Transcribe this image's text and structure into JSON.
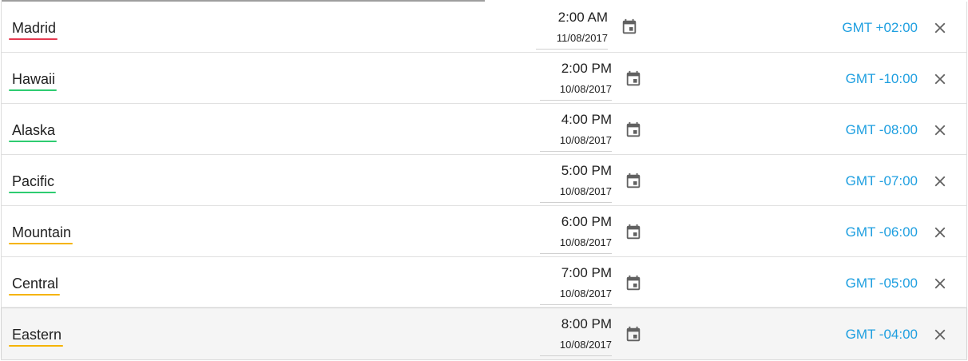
{
  "colors": {
    "accent": "#1e9fe0",
    "icon": "#616161",
    "underline_red": "#e53950",
    "underline_green": "#2ecc71",
    "underline_orange": "#f5b400"
  },
  "icons": {
    "calendar": "calendar-icon",
    "close": "close-icon"
  },
  "timezones": [
    {
      "city": "Madrid",
      "time": "2:00 AM",
      "date": "11/08/2017",
      "offset": "GMT +02:00",
      "underline_color": "#e53950"
    },
    {
      "city": "Hawaii",
      "time": "2:00 PM",
      "date": "10/08/2017",
      "offset": "GMT -10:00",
      "underline_color": "#2ecc71"
    },
    {
      "city": "Alaska",
      "time": "4:00 PM",
      "date": "10/08/2017",
      "offset": "GMT -08:00",
      "underline_color": "#2ecc71"
    },
    {
      "city": "Pacific",
      "time": "5:00 PM",
      "date": "10/08/2017",
      "offset": "GMT -07:00",
      "underline_color": "#2ecc71"
    },
    {
      "city": "Mountain",
      "time": "6:00 PM",
      "date": "10/08/2017",
      "offset": "GMT -06:00",
      "underline_color": "#f5b400"
    },
    {
      "city": "Central",
      "time": "7:00 PM",
      "date": "10/08/2017",
      "offset": "GMT -05:00",
      "underline_color": "#f5b400"
    },
    {
      "city": "Eastern",
      "time": "8:00 PM",
      "date": "10/08/2017",
      "offset": "GMT -04:00",
      "underline_color": "#f5b400"
    }
  ]
}
